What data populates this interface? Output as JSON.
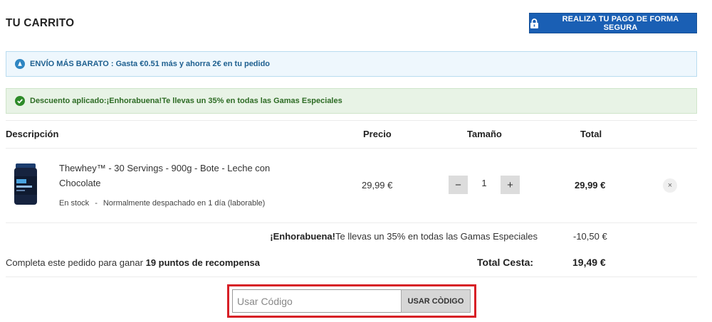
{
  "header": {
    "title": "TU CARRITO",
    "secure_button_label": "REALIZA TU PAGO DE FORMA SEGURA",
    "secure_icon": "lock-icon"
  },
  "alerts": {
    "shipping": {
      "icon": "truck-icon",
      "text": "ENVÍO MÁS BARATO : Gasta €0.51 más y ahorra 2€ en tu pedido",
      "color": "#1d5f8f"
    },
    "discount": {
      "icon": "check-circle-icon",
      "text": "Descuento aplicado:¡Enhorabuena!Te llevas un 35% en todas las Gamas Especiales",
      "color": "#2d6b24"
    }
  },
  "table": {
    "headers": {
      "description": "Descripción",
      "price": "Precio",
      "size": "Tamaño",
      "total": "Total"
    },
    "items": [
      {
        "name": "Thewhey™ - 30 Servings - 900g - Bote - Leche con Chocolate",
        "stock": "En stock",
        "stock_separator": "-",
        "dispatch": "Normalmente despachado en 1 día (laborable)",
        "price": "29,99 €",
        "quantity": "1",
        "decrement": "−",
        "increment": "+",
        "total": "29,99 €",
        "remove": "×"
      }
    ]
  },
  "summary": {
    "discount_bold": "¡Enhorabuena!",
    "discount_rest": "Te llevas un 35% en todas las Gamas Especiales",
    "discount_value": "-10,50 €",
    "points_prefix": "Completa este pedido para ganar",
    "points_bold": "19 puntos de recompensa",
    "total_label": "Total Cesta:",
    "total_value": "19,49 €"
  },
  "coupon": {
    "placeholder": "Usar Código",
    "button_label": "USAR CÒDIGO"
  },
  "colors": {
    "primary_blue": "#1a5fb4",
    "highlight_red": "#d71f26",
    "info_bg": "#eef7fd",
    "success_bg": "#e8f3e6"
  }
}
